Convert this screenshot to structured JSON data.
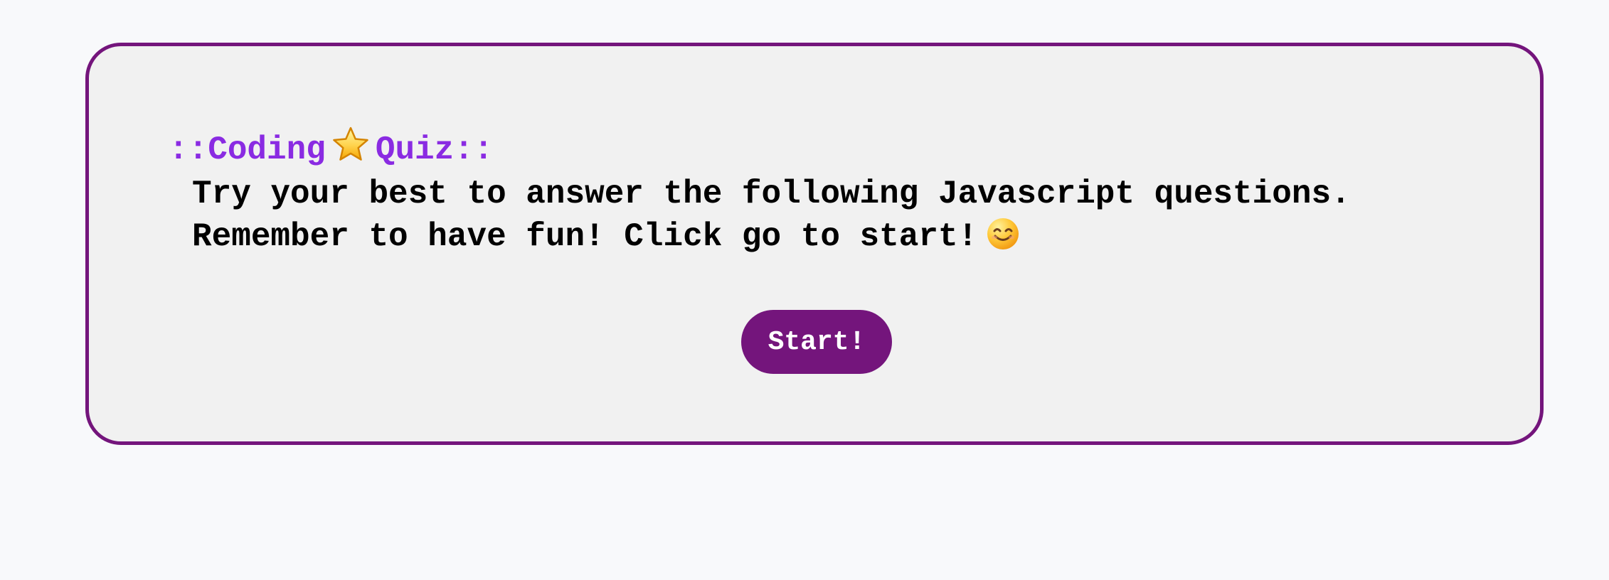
{
  "quiz": {
    "title_prefix": "::Coding",
    "title_suffix": "Quiz::",
    "instructions_line_1": "Try your best to answer the following Javascript questions.",
    "instructions_line_2": "Remember to have fun! Click go to start!",
    "start_label": "Start!"
  },
  "icons": {
    "title_icon": "star-icon",
    "instructions_icon": "smiling-face-icon"
  },
  "colors": {
    "accent": "#74157c",
    "title": "#8a2be2",
    "card_background": "#f1f1f1",
    "page_background": "#f8f9fb",
    "text": "#000000",
    "button_text": "#ffffff"
  }
}
